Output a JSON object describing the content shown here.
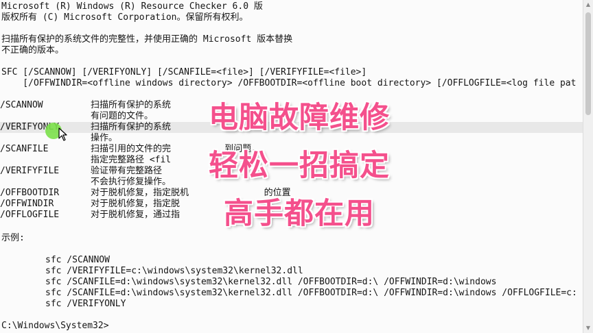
{
  "console": {
    "header": [
      "Microsoft (R) Windows (R) Resource Checker 6.0 版",
      "版权所有 (C) Microsoft Corporation。保留所有权利。"
    ],
    "intro": [
      "扫描所有保护的系统文件的完整性，并使用正确的 Microsoft 版本替换",
      "不正确的版本。"
    ],
    "usage": [
      "SFC [/SCANNOW] [/VERIFYONLY] [/SCANFILE=<file>] [/VERIFYFILE=<file>]",
      "    [/OFFWINDIR=<offline windows directory> /OFFBOOTDIR=<offline boot directory> [/OFFLOGFILE=<log file pat"
    ],
    "options": [
      {
        "switch": "/SCANNOW",
        "desc": [
          "扫描所有保护的系统",
          "有问题的文件。"
        ]
      },
      {
        "switch": "/VERIFYONLY",
        "desc": [
          "扫描所有保护的系统",
          "操作。"
        ]
      },
      {
        "switch": "/SCANFILE",
        "desc": [
          "扫描引用的文件的完          到问题，",
          "指定完整路径 <fil"
        ]
      },
      {
        "switch": "/VERIFYFILE",
        "desc": [
          "验证带有完整路径",
          "不会执行修复操作。"
        ]
      },
      {
        "switch": "/OFFBOOTDIR",
        "desc": [
          "对于脱机修复，指定脱机              的位置"
        ]
      },
      {
        "switch": "/OFFWINDIR",
        "desc": [
          "对于脱机修复，指定脱"
        ]
      },
      {
        "switch": "/OFFLOGFILE",
        "desc": [
          "对于脱机修复，通过指"
        ]
      }
    ],
    "examples_label": "示例:",
    "examples": [
      "sfc /SCANNOW",
      "sfc /VERIFYFILE=c:\\windows\\system32\\kernel32.dll",
      "sfc /SCANFILE=d:\\windows\\system32\\kernel32.dll /OFFBOOTDIR=d:\\ /OFFWINDIR=d:\\windows",
      "sfc /SCANFILE=d:\\windows\\system32\\kernel32.dll /OFFBOOTDIR=d:\\ /OFFWINDIR=d:\\windows /OFFLOGFILE=c:",
      "sfc /VERIFYONLY"
    ],
    "prompt": "C:\\Windows\\System32>"
  },
  "overlay": {
    "line1": "电脑故障维修",
    "line2": "轻松一招搞定",
    "line3": "高手都在用"
  },
  "colors": {
    "console_bg": "#fbfbfb",
    "console_text": "#151515",
    "caption": "#f4508c",
    "click_marker": "#7be04a"
  },
  "icons": {
    "cursor": "arrow-cursor-icon",
    "click": "click-highlight-icon"
  }
}
